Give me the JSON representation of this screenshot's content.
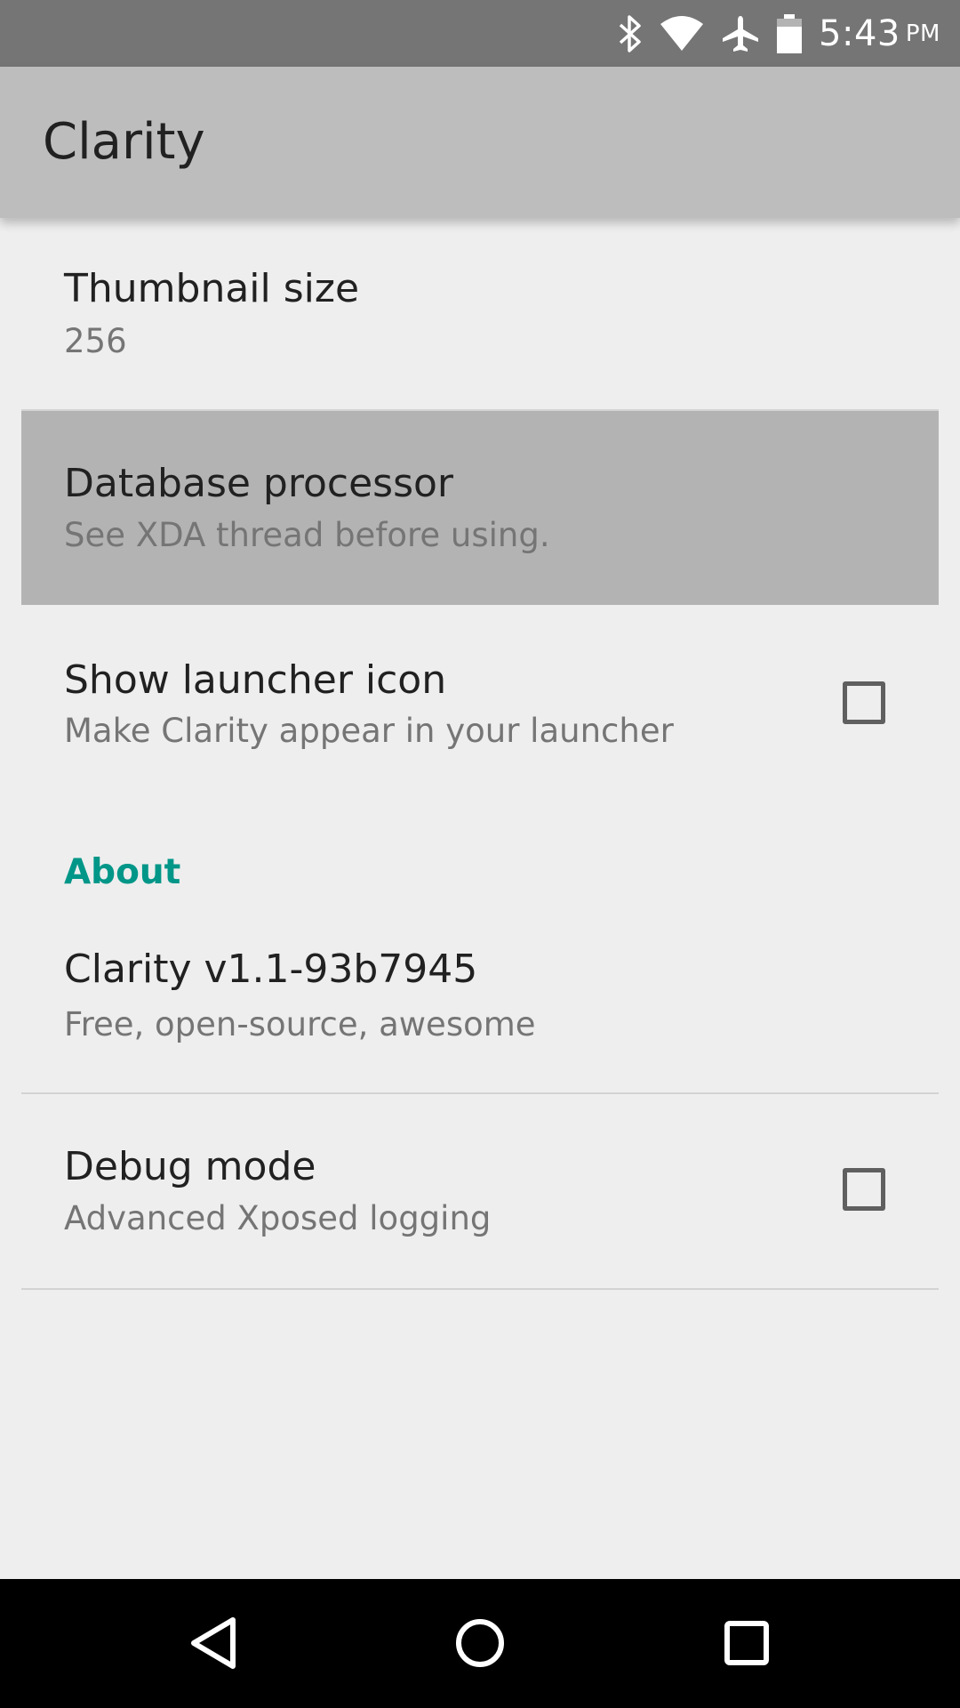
{
  "status_bar": {
    "time": "5:43",
    "ampm": "PM",
    "icons": [
      "bluetooth-icon",
      "wifi-icon",
      "airplane-mode-icon",
      "battery-icon"
    ]
  },
  "app_bar": {
    "title": "Clarity"
  },
  "preferences": [
    {
      "title": "Thumbnail size",
      "summary": "256"
    },
    {
      "title": "Database processor",
      "summary": "See XDA thread before using."
    },
    {
      "title": "Show launcher icon",
      "summary": "Make Clarity appear in your launcher",
      "checked": false
    }
  ],
  "about": {
    "header": "About",
    "items": [
      {
        "title": "Clarity v1.1-93b7945",
        "summary": "Free, open-source, awesome"
      },
      {
        "title": "Debug mode",
        "summary": "Advanced Xposed logging",
        "checked": false
      }
    ]
  },
  "nav_bar": {
    "buttons": [
      "back-icon",
      "home-icon",
      "recents-icon"
    ]
  },
  "colors": {
    "status_bar": "#757575",
    "app_bar": "#bdbdbd",
    "background": "#eeeeee",
    "accent": "#009688",
    "highlight": "#b3b3b3"
  }
}
